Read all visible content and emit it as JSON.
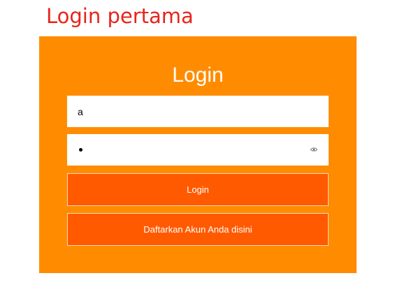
{
  "page": {
    "heading": "Login pertama"
  },
  "login_form": {
    "title": "Login",
    "username_value": "a",
    "password_masked": "•",
    "login_button_label": "Login",
    "register_button_label": "Daftarkan Akun Anda disini"
  },
  "icons": {
    "password_toggle": "eye-icon"
  },
  "colors": {
    "heading": "#e8241c",
    "card_background": "#ff8c00",
    "button_background": "#ff5a00",
    "button_text": "#ffffff"
  }
}
